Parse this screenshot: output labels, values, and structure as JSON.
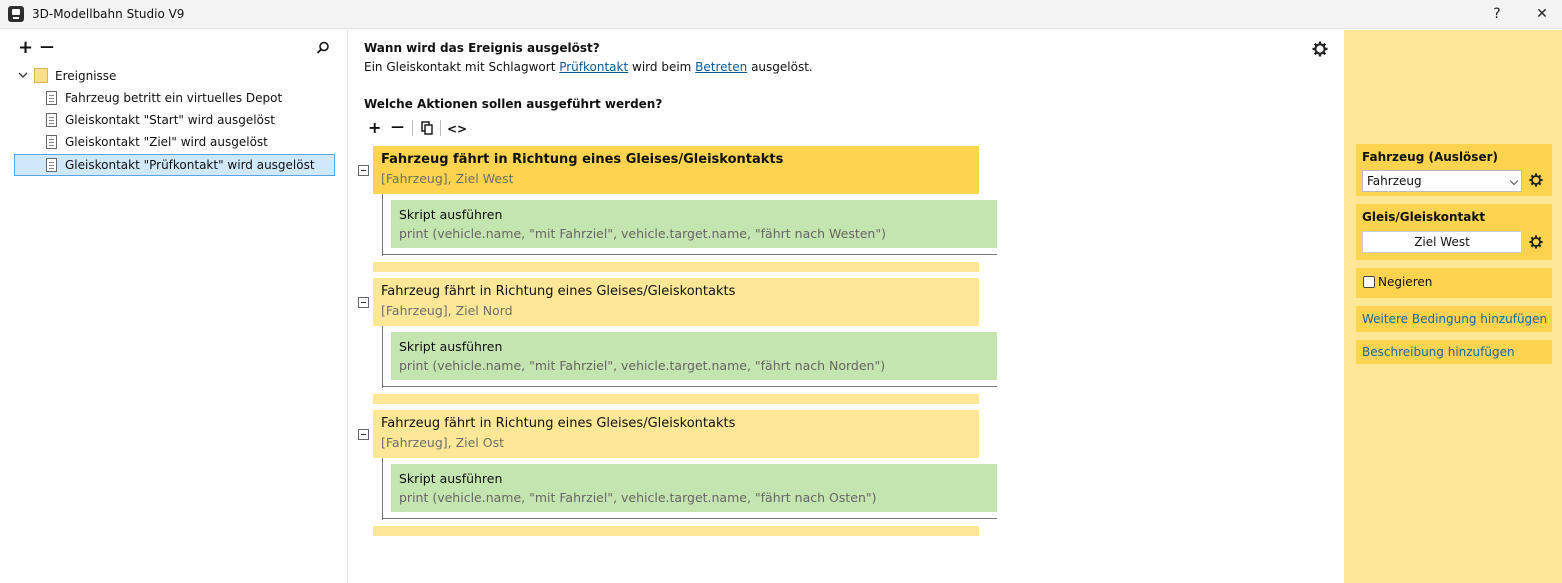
{
  "window": {
    "title": "3D-Modellbahn Studio V9",
    "help_label": "?",
    "close_label": "✕"
  },
  "left": {
    "add_label": "+",
    "remove_label": "—",
    "tree": {
      "root_label": "Ereignisse",
      "items": [
        "Fahrzeug betritt ein virtuelles Depot",
        "Gleiskontakt \"Start\" wird ausgelöst",
        "Gleiskontakt \"Ziel\" wird ausgelöst",
        "Gleiskontakt \"Prüfkontakt\" wird ausgelöst"
      ],
      "selected_index": 3
    }
  },
  "center": {
    "trigger_question": "Wann wird das Ereignis ausgelöst?",
    "trigger_desc": {
      "part1": "Ein Gleiskontakt mit Schlagwort ",
      "link1": "Prüfkontakt",
      "part2": " wird beim ",
      "link2": "Betreten",
      "part3": " ausgelöst."
    },
    "actions_question": "Welche Aktionen sollen ausgeführt werden?",
    "toolbar": {
      "add": "+",
      "remove": "—",
      "code": "<>"
    },
    "blocks": [
      {
        "title": "Fahrzeug fährt in Richtung eines Gleises/Gleiskontakts",
        "subtitle": "[Fahrzeug], Ziel West",
        "action_title": "Skript ausführen",
        "action_code": "print (vehicle.name, \"mit Fahrziel\", vehicle.target.name, \"fährt nach Westen\")"
      },
      {
        "title": "Fahrzeug fährt in Richtung eines Gleises/Gleiskontakts",
        "subtitle": "[Fahrzeug], Ziel Nord",
        "action_title": "Skript ausführen",
        "action_code": "print (vehicle.name, \"mit Fahrziel\", vehicle.target.name, \"fährt nach Norden\")"
      },
      {
        "title": "Fahrzeug fährt in Richtung eines Gleises/Gleiskontakts",
        "subtitle": "[Fahrzeug], Ziel Ost",
        "action_title": "Skript ausführen",
        "action_code": "print (vehicle.name, \"mit Fahrziel\", vehicle.target.name, \"fährt nach Osten\")"
      }
    ]
  },
  "right": {
    "vehicle_label": "Fahrzeug (Auslöser)",
    "vehicle_value": "Fahrzeug",
    "track_label": "Gleis/Gleiskontakt",
    "track_value": "Ziel West",
    "negate_label": "Negieren",
    "add_condition": "Weitere Bedingung hinzufügen",
    "add_description": "Beschreibung hinzufügen"
  },
  "colors": {
    "active_block": "#fdd34f",
    "block": "#fee898",
    "action_block": "#c5e5b0",
    "link": "#0a5a95"
  }
}
